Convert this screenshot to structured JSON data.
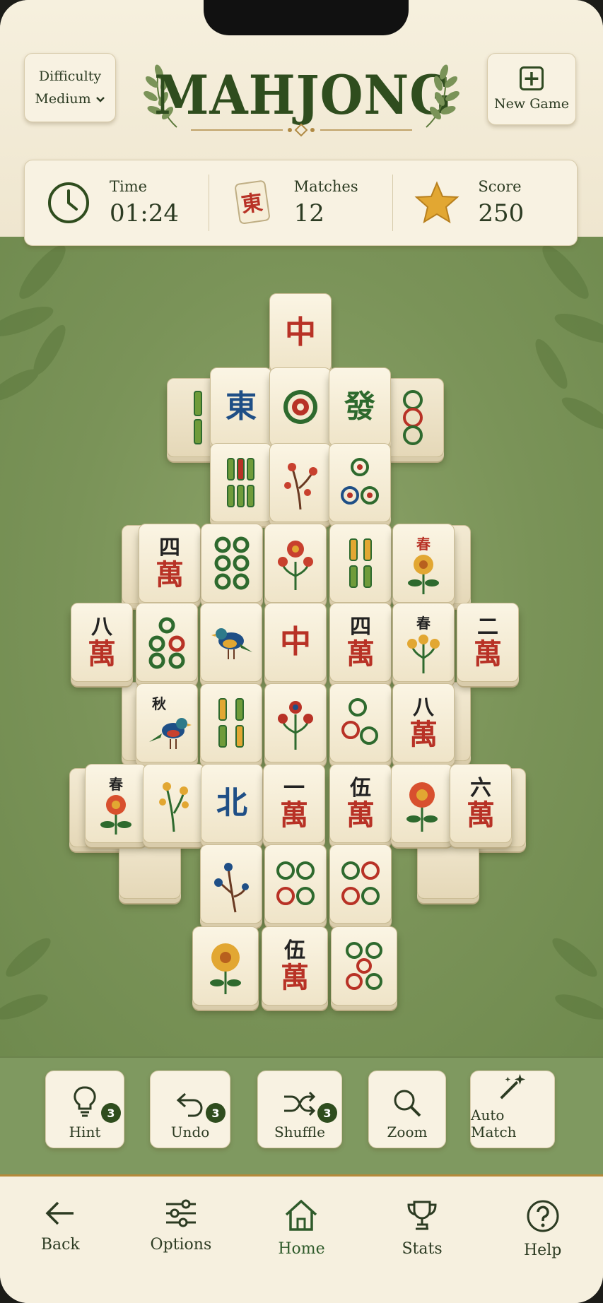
{
  "app": {
    "title": "MAHJONG"
  },
  "difficulty": {
    "label": "Difficulty",
    "value": "Medium"
  },
  "new_game": {
    "label": "New Game"
  },
  "stats": {
    "time": {
      "label": "Time",
      "value": "01:24"
    },
    "matches": {
      "label": "Matches",
      "value": "12"
    },
    "score": {
      "label": "Score",
      "value": "250"
    }
  },
  "tile_faces": {
    "zhong": "中",
    "dong": "東",
    "fa": "發",
    "bei": "北",
    "wan": "萬",
    "si": "四",
    "ba": "八",
    "er": "二",
    "yi": "一",
    "wu": "伍",
    "liu": "六",
    "chun": "春",
    "qiu": "秋"
  },
  "actions": {
    "hint": {
      "label": "Hint",
      "count": "3"
    },
    "undo": {
      "label": "Undo",
      "count": "3"
    },
    "shuffle": {
      "label": "Shuffle",
      "count": "3"
    },
    "zoom": {
      "label": "Zoom"
    },
    "auto_match": {
      "label": "Auto Match"
    }
  },
  "nav": {
    "back": "Back",
    "options": "Options",
    "home": "Home",
    "stats": "Stats",
    "help": "Help"
  },
  "colors": {
    "accent": "#2f4d1e",
    "felt": "#7a9358",
    "tile": "#f8f1de",
    "red_char": "#b83226",
    "blue_char": "#1f4f86"
  }
}
